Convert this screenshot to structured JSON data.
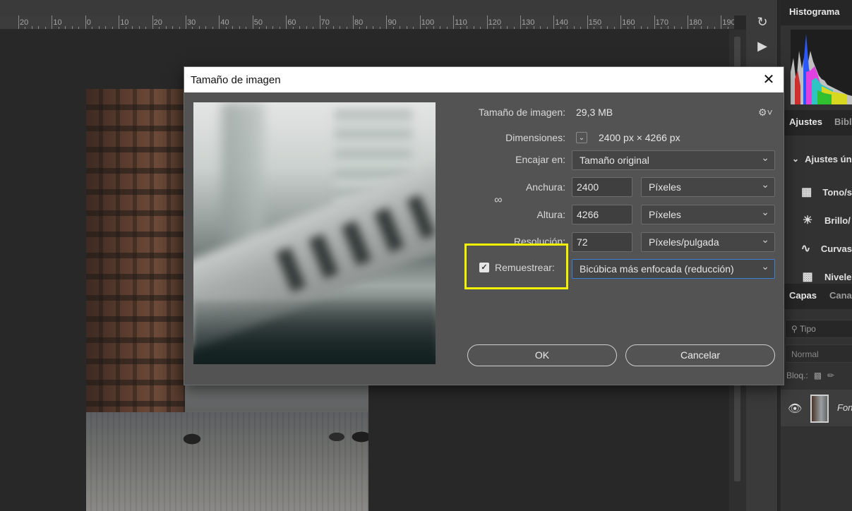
{
  "ruler": {
    "labels": [
      "20",
      "10",
      "0",
      "10",
      "20",
      "30",
      "40",
      "50",
      "60",
      "70",
      "80",
      "90",
      "100",
      "110",
      "120",
      "130",
      "140",
      "150",
      "160",
      "170",
      "180",
      "190"
    ]
  },
  "right_panel": {
    "histogram_tab": "Histograma",
    "adjustments_tabs": [
      "Ajustes",
      "Bibli"
    ],
    "adjustments_header": "Ajustes úni",
    "adjust_items": [
      {
        "label": "Tono/s",
        "icon": "tone-icon"
      },
      {
        "label": "Brillo/",
        "icon": "brightness-icon"
      },
      {
        "label": "Curvas",
        "icon": "curves-icon"
      },
      {
        "label": "Nivele",
        "icon": "levels-icon"
      }
    ],
    "layers_tabs": [
      "Capas",
      "Canal"
    ],
    "search_placeholder": "Tipo",
    "blend_mode": "Normal",
    "lock_label": "Bloq.:",
    "layer_name": "Fon"
  },
  "dialog": {
    "title": "Tamaño de imagen",
    "image_size_label": "Tamaño de imagen:",
    "image_size_value": "29,3 MB",
    "dimensions_label": "Dimensiones:",
    "dimensions_value": "2400 px × 4266 px",
    "fit_label": "Encajar en:",
    "fit_value": "Tamaño original",
    "width_label": "Anchura:",
    "width_value": "2400",
    "width_unit": "Píxeles",
    "height_label": "Altura:",
    "height_value": "4266",
    "height_unit": "Píxeles",
    "resolution_label": "Resolución:",
    "resolution_value": "72",
    "resolution_unit": "Píxeles/pulgada",
    "resample_label": "Remuestrear:",
    "resample_checked": true,
    "resample_value": "Bicúbica más enfocada (reducción)",
    "ok_label": "OK",
    "cancel_label": "Cancelar",
    "highlight_color": "#f2f200"
  }
}
